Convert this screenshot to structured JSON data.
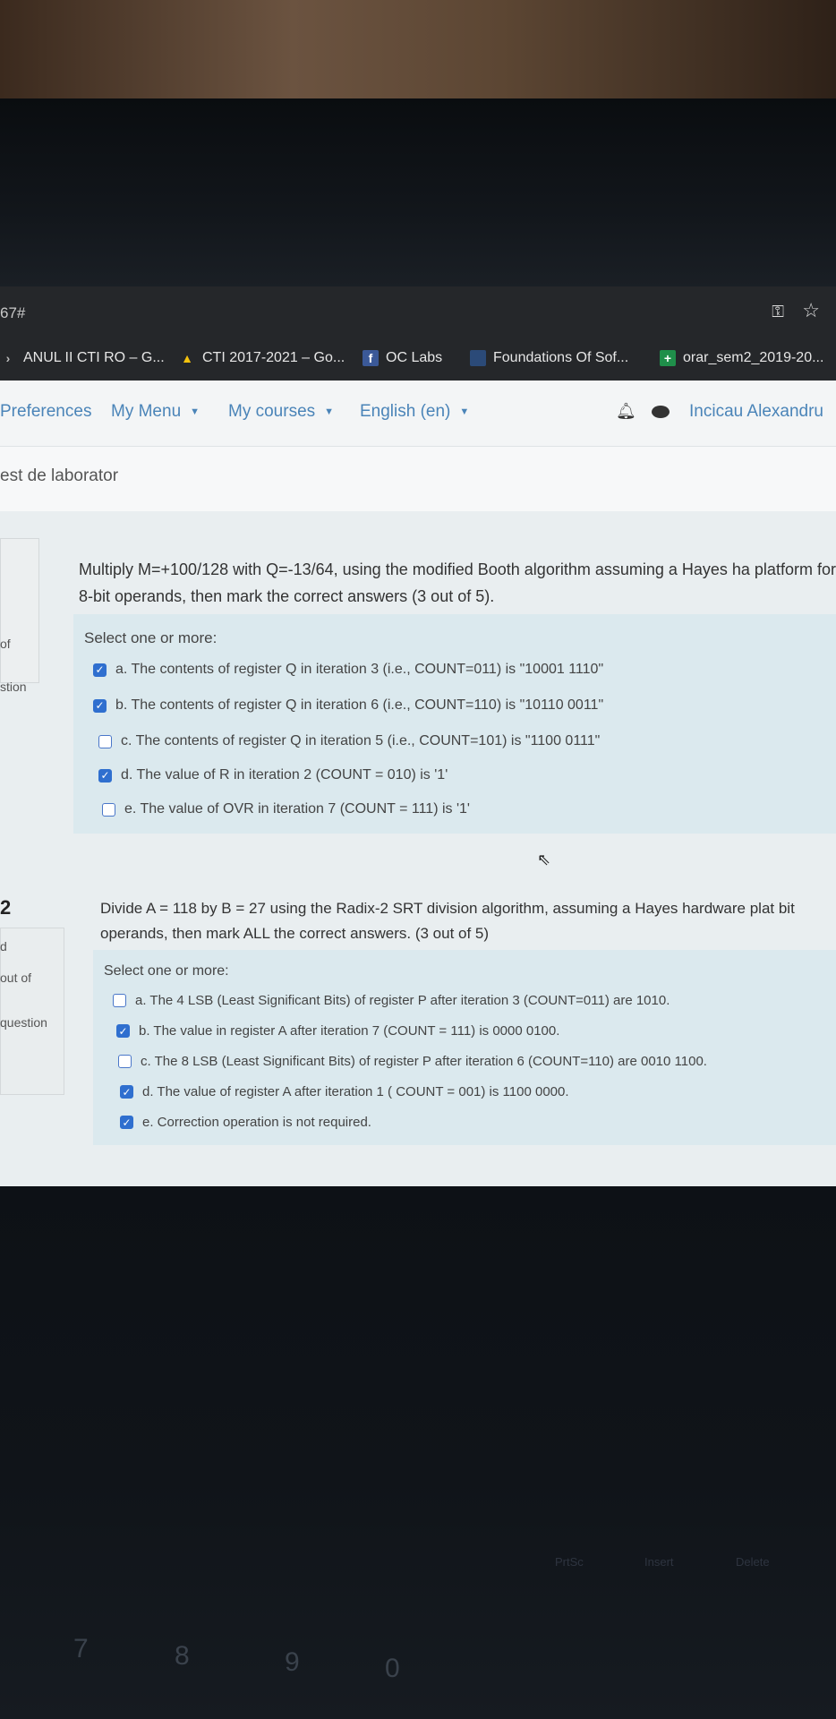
{
  "browser": {
    "url_fragment": "67#",
    "bookmarks": [
      {
        "label": "ANUL II CTI RO – G...",
        "icon": "folder-icon"
      },
      {
        "label": "CTI 2017-2021 – Go...",
        "icon": "google-drive-icon"
      },
      {
        "label": "OC Labs",
        "icon": "facebook-icon"
      },
      {
        "label": "Foundations Of Sof...",
        "icon": "blue-square-icon"
      },
      {
        "label": "orar_sem2_2019-20...",
        "icon": "sheets-plus-icon"
      }
    ]
  },
  "navbar": {
    "items": [
      "Preferences",
      "My Menu",
      "My courses",
      "English (en)"
    ],
    "username": "Incicau Alexandru"
  },
  "breadcrumb": "est de laborator",
  "sidebar": {
    "q1_fragments": [
      "of",
      "stion"
    ],
    "q2_number": "2",
    "q2_fragments": [
      "d",
      "out of",
      "question"
    ]
  },
  "questions": [
    {
      "text": "Multiply M=+100/128 with Q=-13/64, using the modified Booth algorithm assuming a Hayes ha platform for 8-bit operands, then mark the correct answers (3 out of 5).",
      "select_label": "Select one or more:",
      "options": [
        {
          "text": "a. The contents of register Q in iteration 3 (i.e., COUNT=011) is \"10001 1110\"",
          "checked": true
        },
        {
          "text": "b. The contents of register Q in iteration 6 (i.e., COUNT=110) is \"10110 0011\"",
          "checked": true
        },
        {
          "text": "c. The contents of register Q in iteration 5 (i.e., COUNT=101) is \"1100 0111\"",
          "checked": false
        },
        {
          "text": "d. The value of R in iteration 2 (COUNT = 010) is '1'",
          "checked": true
        },
        {
          "text": "e. The value of OVR in iteration 7 (COUNT = 111) is '1'",
          "checked": false
        }
      ]
    },
    {
      "text": "Divide A = 118 by B = 27 using the Radix-2 SRT division algorithm, assuming a Hayes hardware plat bit operands, then mark ALL the correct answers. (3 out of 5)",
      "select_label": "Select one or more:",
      "options": [
        {
          "text": "a. The 4 LSB (Least Significant Bits) of register P after iteration 3 (COUNT=011) are 1010.",
          "checked": false
        },
        {
          "text": "b. The value in register A after iteration 7 (COUNT = 111) is 0000 0100.",
          "checked": true
        },
        {
          "text": "c. The 8 LSB (Least Significant Bits) of register P after iteration 6 (COUNT=110) are 0010 1100.",
          "checked": false
        },
        {
          "text": "d. The value of register A after iteration 1 ( COUNT = 001) is 1100 0000.",
          "checked": true
        },
        {
          "text": "e. Correction operation is not required.",
          "checked": true
        }
      ]
    }
  ],
  "keyboard": {
    "fkeys": [
      "PrtSc",
      "Insert",
      "Delete"
    ],
    "numbers": [
      "7",
      "8",
      "9",
      "0"
    ]
  },
  "colors": {
    "link": "#4a84b8",
    "checkbox": "#2f6fcf",
    "answer_bg": "#dbe9ee",
    "chrome": "#25272a"
  }
}
